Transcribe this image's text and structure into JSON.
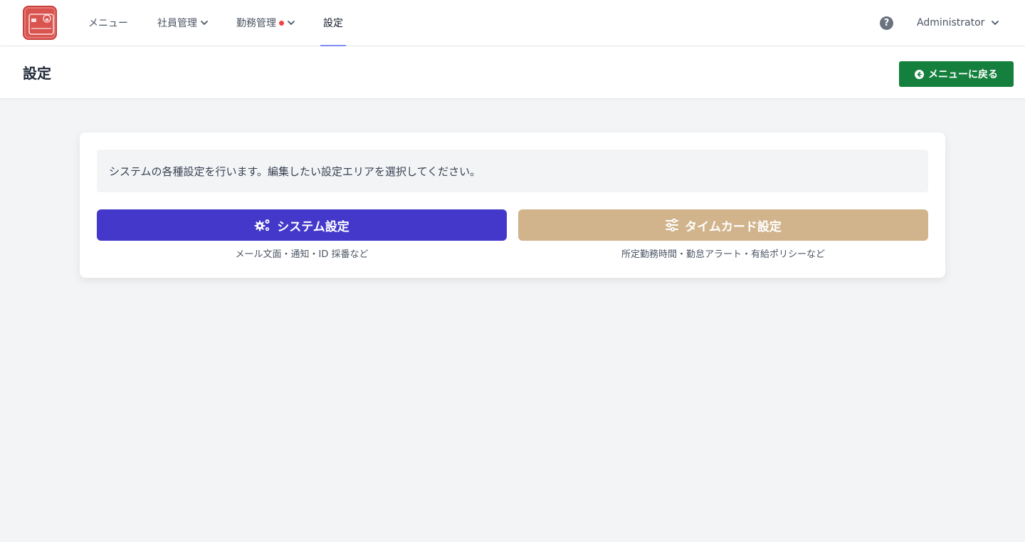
{
  "nav": {
    "items": [
      {
        "label": "メニュー"
      },
      {
        "label": "社員管理"
      },
      {
        "label": "勤務管理"
      },
      {
        "label": "設定"
      }
    ],
    "user": "Administrator",
    "help_glyph": "?"
  },
  "header": {
    "title": "設定",
    "back_label": "メニューに戻る"
  },
  "card": {
    "notice": "システムの各種設定を行います。編集したい設定エリアを選択してください。",
    "options": [
      {
        "label": "システム設定",
        "description": "メール文面・通知・ID 採番など",
        "color": "#4338ca",
        "icon": "cogs-icon"
      },
      {
        "label": "タイムカード設定",
        "description": "所定勤務時間・勤怠アラート・有給ポリシーなど",
        "color": "#d2b48c",
        "icon": "sliders-icon"
      }
    ]
  },
  "colors": {
    "accent": "#818cf8",
    "back_button": "#15803d",
    "notification_dot": "#ef4444",
    "logo": "#d9534f"
  }
}
